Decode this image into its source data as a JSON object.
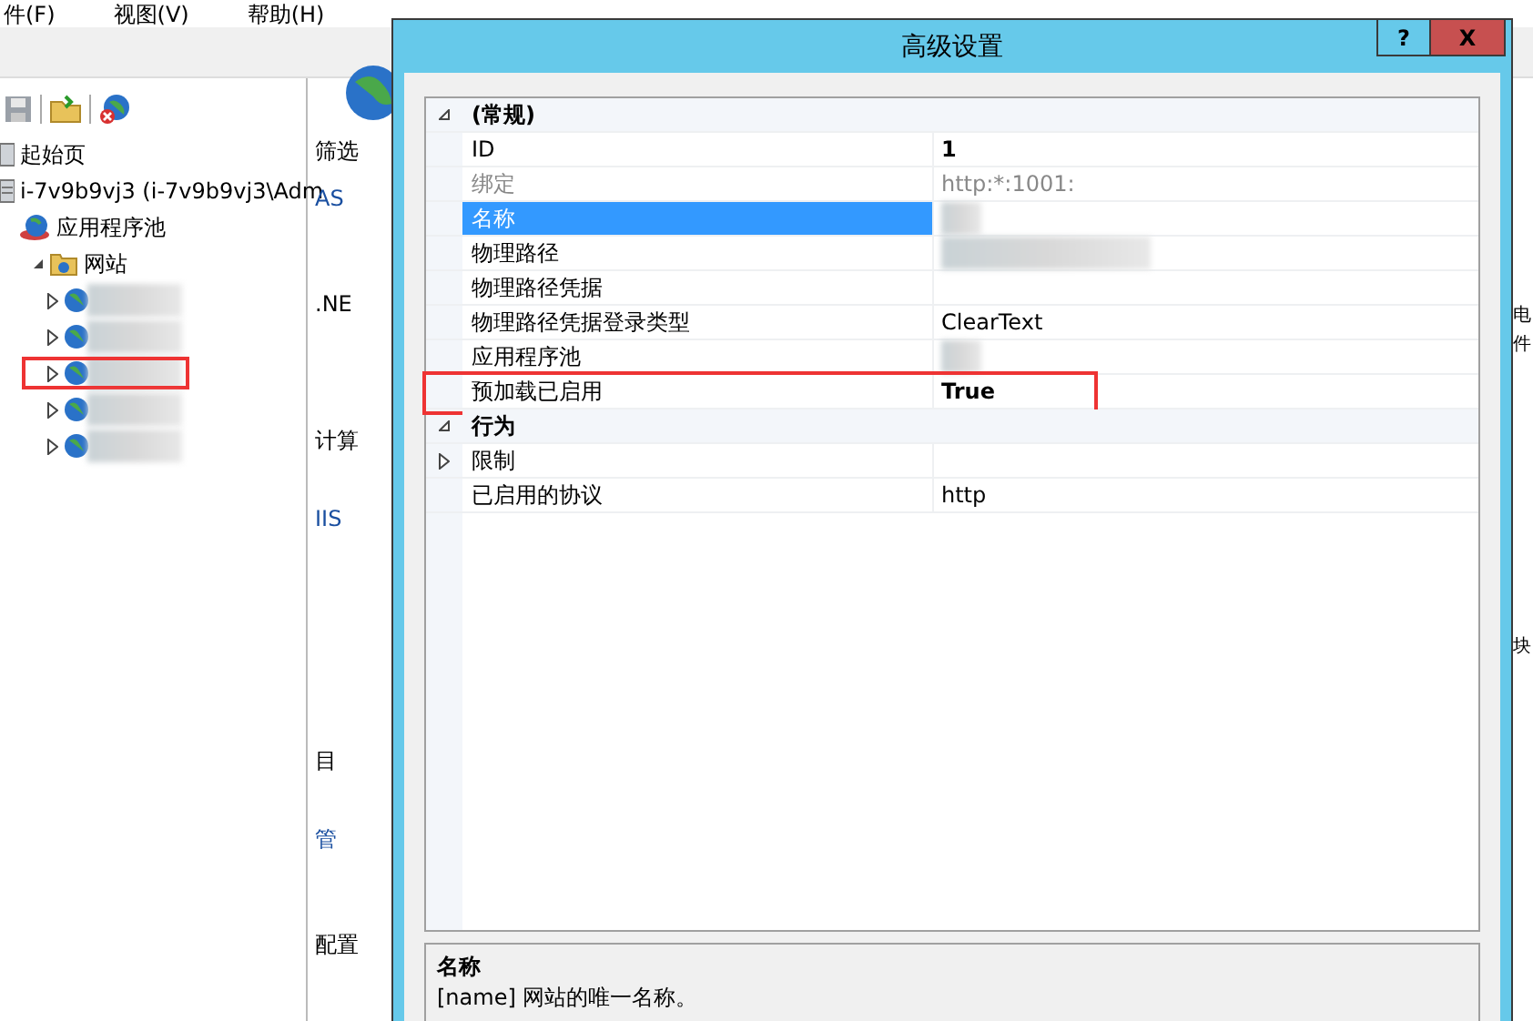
{
  "menu": [
    "件(F)",
    "视图(V)",
    "帮助(H)"
  ],
  "tree": [
    {
      "label": "起始页",
      "kind": "page"
    },
    {
      "label": "i-7v9b9vj3 (i-7v9b9vj3\\Adm",
      "kind": "server",
      "children": [
        {
          "label": "应用程序池",
          "kind": "pool"
        },
        {
          "label": "网站",
          "kind": "folder",
          "expanded": true,
          "children": [
            {
              "kind": "site",
              "redacted": true,
              "highlighted": false
            },
            {
              "kind": "site",
              "redacted": true,
              "highlighted": false
            },
            {
              "kind": "site",
              "redacted": true,
              "highlighted": true
            },
            {
              "kind": "site",
              "redacted": true,
              "highlighted": false
            },
            {
              "kind": "site",
              "redacted": true,
              "highlighted": false
            }
          ]
        }
      ]
    }
  ],
  "main_pane": {
    "texts": [
      {
        "text": "筛选",
        "kind": "label"
      },
      {
        "text": "AS",
        "kind": "link"
      },
      {
        "text": ".NE",
        "kind": "label"
      },
      {
        "text": "计算",
        "kind": "label"
      },
      {
        "text": "IIS",
        "kind": "link"
      },
      {
        "text": "目",
        "kind": "label"
      },
      {
        "text": "管",
        "kind": "link"
      },
      {
        "text": "配置",
        "kind": "label"
      }
    ]
  },
  "edge_texts": [
    "电",
    "件",
    "块"
  ],
  "dialog": {
    "title": "高级设置",
    "help_button": "?",
    "close_button": "X",
    "categories": [
      {
        "name": "(常规)",
        "expanded": true,
        "properties": [
          {
            "name": "ID",
            "value": "1",
            "bold": true,
            "selected": false,
            "disabled": false,
            "redacted": false,
            "highlighted": false
          },
          {
            "name": "绑定",
            "value": "http:*:1001:",
            "bold": false,
            "selected": false,
            "disabled": true,
            "redacted": false,
            "highlighted": false
          },
          {
            "name": "名称",
            "selected": true,
            "disabled": false,
            "redacted": true,
            "highlighted": false
          },
          {
            "name": "物理路径",
            "selected": false,
            "disabled": false,
            "redacted": true,
            "highlighted": false
          },
          {
            "name": "物理路径凭据",
            "selected": false,
            "disabled": false,
            "redacted": false,
            "highlighted": false
          },
          {
            "name": "物理路径凭据登录类型",
            "value": "ClearText",
            "bold": false,
            "selected": false,
            "disabled": false,
            "redacted": false,
            "highlighted": false
          },
          {
            "name": "应用程序池",
            "selected": false,
            "disabled": false,
            "redacted": true,
            "highlighted": false
          },
          {
            "name": "预加载已启用",
            "value": "True",
            "bold": true,
            "selected": false,
            "disabled": false,
            "redacted": false,
            "highlighted": true
          }
        ]
      },
      {
        "name": "行为",
        "expanded": true,
        "properties": [
          {
            "name": "限制",
            "expandable": true,
            "selected": false,
            "disabled": false,
            "redacted": false,
            "highlighted": false
          },
          {
            "name": "已启用的协议",
            "value": "http",
            "bold": false,
            "selected": false,
            "disabled": false,
            "redacted": false,
            "highlighted": false
          }
        ]
      }
    ],
    "description": {
      "title": "名称",
      "text": "[name] 网站的唯一名称。"
    }
  }
}
